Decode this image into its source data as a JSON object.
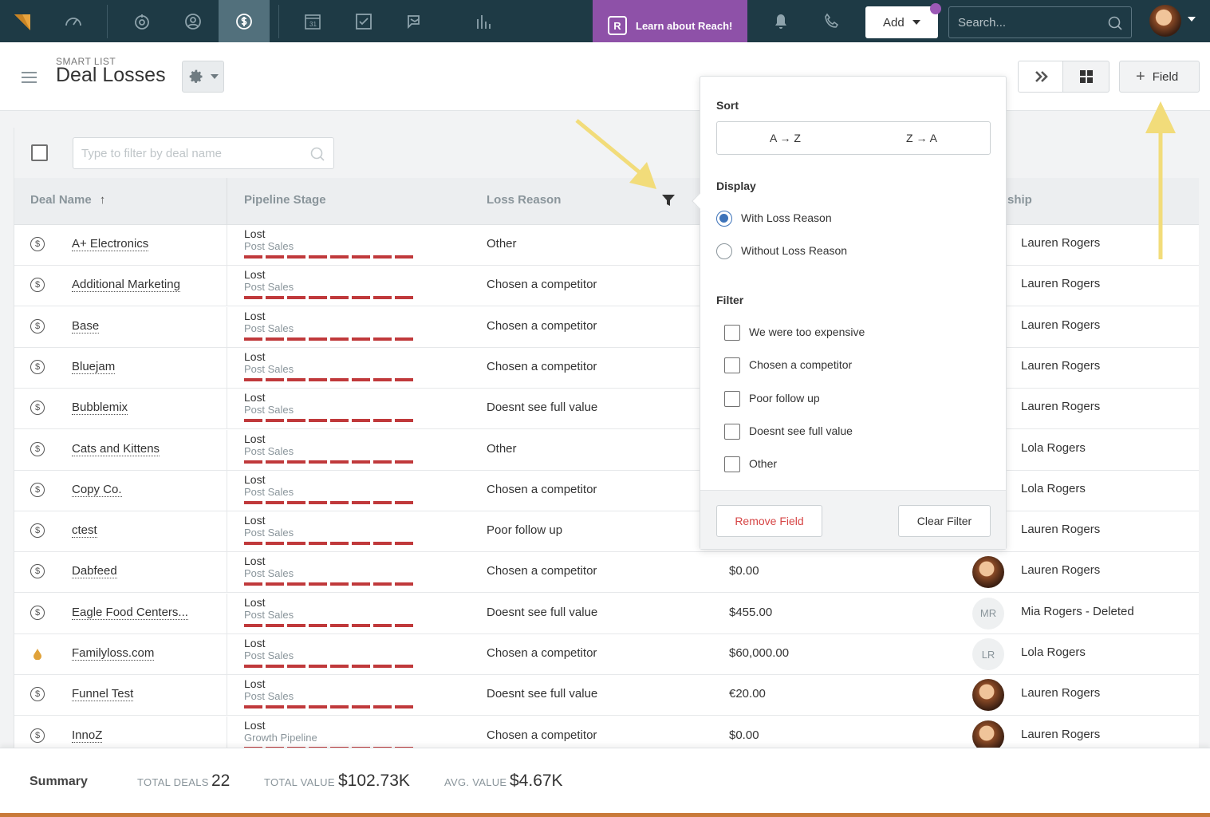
{
  "nav": {
    "reach_label": "Learn about Reach!",
    "add_label": "Add",
    "search_placeholder": "Search..."
  },
  "header": {
    "smart_list_label": "SMART LIST",
    "title": "Deal Losses",
    "field_button": "Field"
  },
  "filter": {
    "placeholder": "Type to filter by deal name"
  },
  "columns": {
    "deal_name": "Deal Name",
    "sort_arrow": "↑",
    "pipeline_stage": "Pipeline Stage",
    "loss_reason": "Loss Reason",
    "ownership": "ship"
  },
  "rows": [
    {
      "name": "A+ Electronics",
      "stage": "Lost",
      "pipeline": "Post Sales",
      "loss": "Other",
      "value": "",
      "avatar": "",
      "owner": "Lauren Rogers",
      "icon": "dollar-icon"
    },
    {
      "name": "Additional Marketing",
      "stage": "Lost",
      "pipeline": "Post Sales",
      "loss": "Chosen a competitor",
      "value": "",
      "avatar": "",
      "owner": "Lauren Rogers",
      "icon": "dollar-icon"
    },
    {
      "name": "Base",
      "stage": "Lost",
      "pipeline": "Post Sales",
      "loss": "Chosen a competitor",
      "value": "",
      "avatar": "",
      "owner": "Lauren Rogers",
      "icon": "dollar-icon"
    },
    {
      "name": "Bluejam",
      "stage": "Lost",
      "pipeline": "Post Sales",
      "loss": "Chosen a competitor",
      "value": "",
      "avatar": "",
      "owner": "Lauren Rogers",
      "icon": "dollar-icon"
    },
    {
      "name": "Bubblemix",
      "stage": "Lost",
      "pipeline": "Post Sales",
      "loss": "Doesnt see full value",
      "value": "",
      "avatar": "",
      "owner": "Lauren Rogers",
      "icon": "dollar-icon"
    },
    {
      "name": "Cats and Kittens",
      "stage": "Lost",
      "pipeline": "Post Sales",
      "loss": "Other",
      "value": "",
      "avatar": "",
      "owner": "Lola Rogers",
      "icon": "dollar-icon"
    },
    {
      "name": "Copy Co.",
      "stage": "Lost",
      "pipeline": "Post Sales",
      "loss": "Chosen a competitor",
      "value": "",
      "avatar": "",
      "owner": "Lola Rogers",
      "icon": "dollar-icon"
    },
    {
      "name": "ctest",
      "stage": "Lost",
      "pipeline": "Post Sales",
      "loss": "Poor follow up",
      "value": "",
      "avatar": "",
      "owner": "Lauren Rogers",
      "icon": "dollar-icon"
    },
    {
      "name": "Dabfeed",
      "stage": "Lost",
      "pipeline": "Post Sales",
      "loss": "Chosen a competitor",
      "value": "$0.00",
      "avatar": "photo",
      "owner": "Lauren Rogers",
      "icon": "dollar-icon"
    },
    {
      "name": "Eagle Food Centers...",
      "stage": "Lost",
      "pipeline": "Post Sales",
      "loss": "Doesnt see full value",
      "value": "$455.00",
      "avatar": "MR",
      "owner": "Mia Rogers - Deleted",
      "icon": "dollar-icon"
    },
    {
      "name": "Familyloss.com",
      "stage": "Lost",
      "pipeline": "Post Sales",
      "loss": "Chosen a competitor",
      "value": "$60,000.00",
      "avatar": "LR",
      "owner": "Lola Rogers",
      "icon": "drop-icon"
    },
    {
      "name": "Funnel Test",
      "stage": "Lost",
      "pipeline": "Post Sales",
      "loss": "Doesnt see full value",
      "value": "€20.00",
      "avatar": "photo",
      "owner": "Lauren Rogers",
      "icon": "dollar-icon"
    },
    {
      "name": "InnoZ",
      "stage": "Lost",
      "pipeline": "Growth Pipeline",
      "loss": "Chosen a competitor",
      "value": "$0.00",
      "avatar": "photo",
      "owner": "Lauren Rogers",
      "icon": "dollar-icon"
    }
  ],
  "popover": {
    "sort_heading": "Sort",
    "sort_az": "A → Z",
    "sort_za": "Z → A",
    "display_heading": "Display",
    "display_with": "With Loss Reason",
    "display_without": "Without Loss Reason",
    "filter_heading": "Filter",
    "filter_options": [
      "We were too expensive",
      "Chosen a competitor",
      "Poor follow up",
      "Doesnt see full value",
      "Other"
    ],
    "remove_field": "Remove Field",
    "clear_filter": "Clear Filter"
  },
  "summary": {
    "title": "Summary",
    "total_deals_label": "TOTAL DEALS",
    "total_deals": "22",
    "total_value_label": "TOTAL VALUE",
    "total_value": "$102.73K",
    "avg_value_label": "AVG. VALUE",
    "avg_value": "$4.67K"
  },
  "colors": {
    "nav_bg": "#1e3a45",
    "reach_purple": "#8e51a8",
    "stage_red": "#c0393b",
    "radio_blue": "#3d73b9"
  }
}
